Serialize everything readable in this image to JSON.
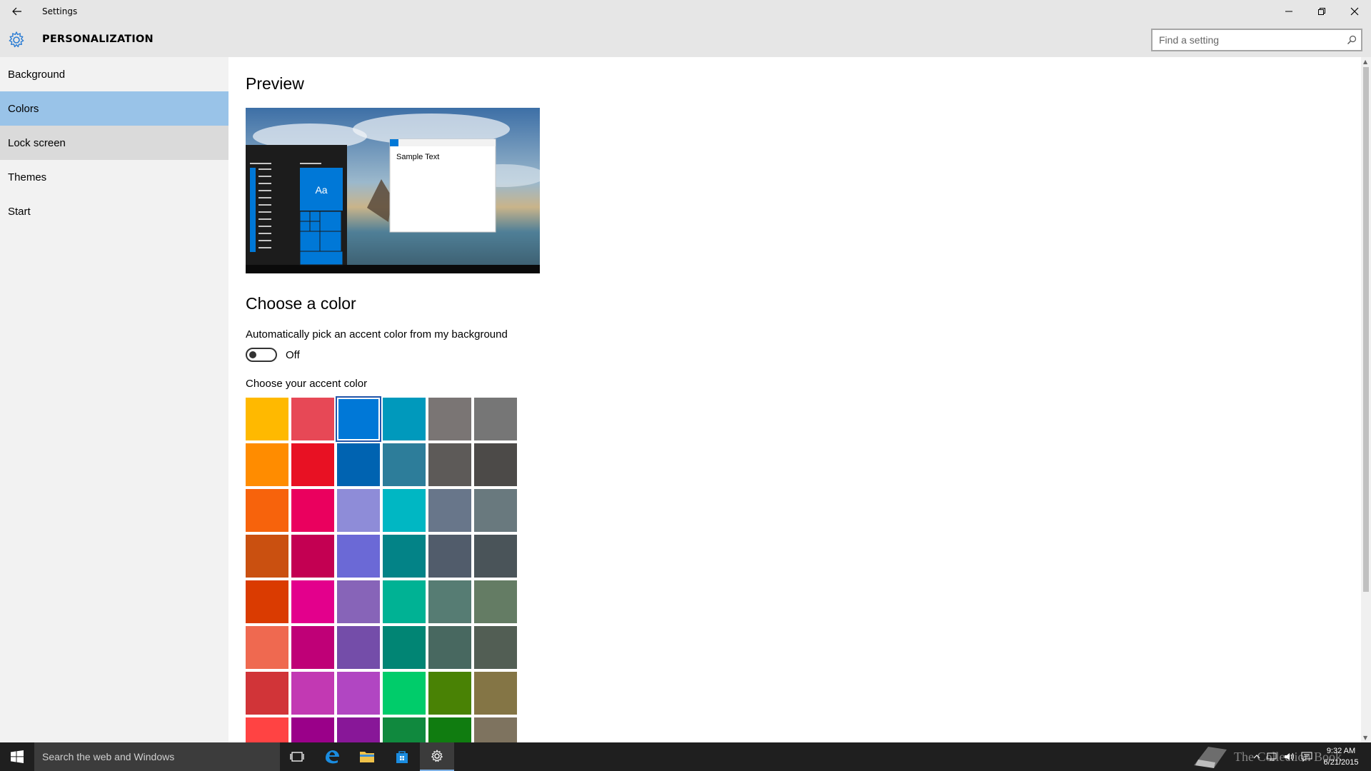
{
  "window": {
    "title": "Settings",
    "section": "PERSONALIZATION"
  },
  "search": {
    "placeholder": "Find a setting"
  },
  "sidebar": {
    "items": [
      {
        "label": "Background"
      },
      {
        "label": "Colors"
      },
      {
        "label": "Lock screen"
      },
      {
        "label": "Themes"
      },
      {
        "label": "Start"
      }
    ]
  },
  "main": {
    "preview_heading": "Preview",
    "preview_sample_text": "Sample Text",
    "preview_tile_text": "Aa",
    "choose_color_heading": "Choose a color",
    "auto_pick_label": "Automatically pick an accent color from my background",
    "auto_pick_state": "Off",
    "accent_label": "Choose your accent color"
  },
  "accent_colors": [
    "#ffb900",
    "#e74856",
    "#0078d7",
    "#0099bc",
    "#7a7574",
    "#767676",
    "#ff8c00",
    "#e81123",
    "#0063b1",
    "#2d7d9a",
    "#5d5a58",
    "#4c4a48",
    "#f7630c",
    "#ea005e",
    "#8e8cd8",
    "#00b7c3",
    "#68768a",
    "#69797e",
    "#ca5010",
    "#c30052",
    "#6b69d6",
    "#038387",
    "#515c6b",
    "#4a5459",
    "#da3b01",
    "#e3008c",
    "#8764b8",
    "#00b294",
    "#567c73",
    "#647c64",
    "#ef6950",
    "#bf0077",
    "#744da9",
    "#018574",
    "#486860",
    "#525e54",
    "#d13438",
    "#c239b3",
    "#b146c2",
    "#00cc6a",
    "#498205",
    "#847545",
    "#ff4343",
    "#9a0089",
    "#881798",
    "#10893e",
    "#107c10",
    "#7e735f"
  ],
  "selected_accent": "#0078d7",
  "taskbar": {
    "search_placeholder": "Search the web and Windows",
    "time": "9:32 AM",
    "date": "6/21/2015",
    "watermark": "The Collection Book"
  }
}
